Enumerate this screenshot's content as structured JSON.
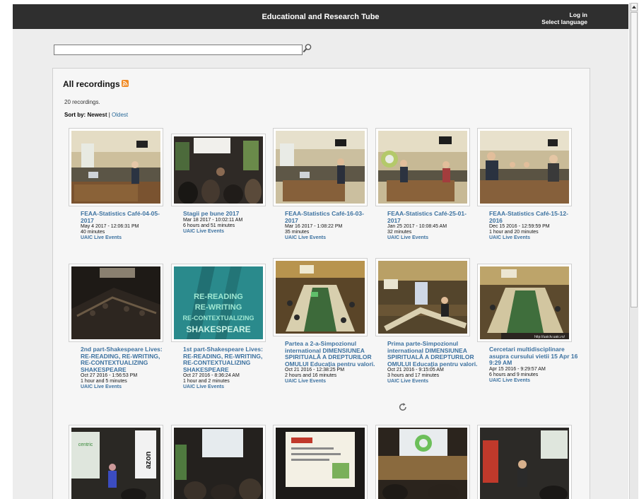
{
  "header": {
    "title": "Educational and Research Tube",
    "login": "Log in",
    "language": "Select language"
  },
  "search": {
    "value": "",
    "placeholder": ""
  },
  "main": {
    "title": "All recordings",
    "count_text": "20 recordings.",
    "sort": {
      "label": "Sort by:",
      "current": "Newest",
      "separator": "|",
      "other": "Oldest"
    }
  },
  "recordings": [
    {
      "title": "FEAA-Statistics Café-04-05-2017",
      "date": "May 4 2017 - 12:06:31 PM",
      "duration": "40 minutes",
      "channel": "UAIC Live Events"
    },
    {
      "title": "Stagii pe bune 2017",
      "date": "Mar 18 2017 - 10:02:11 AM",
      "duration": "6 hours and 51 minutes",
      "channel": "UAIC Live Events"
    },
    {
      "title": "FEAA-Statistics Café-16-03-2017",
      "date": "Mar 16 2017 - 1:08:22 PM",
      "duration": "35 minutes",
      "channel": "UAIC Live Events"
    },
    {
      "title": "FEAA-Statistics Café-25-01-2017",
      "date": "Jan 25 2017 - 10:08:45 AM",
      "duration": "32 minutes",
      "channel": "UAIC Live Events"
    },
    {
      "title": "FEAA-Statistics Café-15-12-2016",
      "date": "Dec 15 2016 - 12:59:59 PM",
      "duration": "1 hour and 20 minutes",
      "channel": "UAIC Live Events"
    },
    {
      "title": "2nd part-Shakespeare Lives: RE-READING, RE-WRITING, RE-CONTEXTUALIZING SHAKESPEARE",
      "date": "Oct 27 2016 - 1:56:53 PM",
      "duration": "1 hour and 5 minutes",
      "channel": "UAIC Live Events"
    },
    {
      "title": "1st part-Shakespeare Lives: RE-READING, RE-WRITING, RE-CONTEXTUALIZING SHAKESPEARE",
      "date": "Oct 27 2016 - 8:36:24 AM",
      "duration": "1 hour and 2 minutes",
      "channel": "UAIC Live Events"
    },
    {
      "title": "Partea a 2-a-Simpozionul international DIMENSIUNEA SPIRITUALĂ A DREPTURILOR OMULUI Educația pentru valori.",
      "date": "Oct 21 2016 - 12:38:25 PM",
      "duration": "2 hours and 16 minutes",
      "channel": "UAIC Live Events"
    },
    {
      "title": "Prima parte-Simpozionul international DIMENSIUNEA SPIRITUALĂ A DREPTURILOR OMULUI Educația pentru valori.",
      "date": "Oct 21 2016 - 9:15:05 AM",
      "duration": "3 hours and 17 minutes",
      "channel": "UAIC Live Events"
    },
    {
      "title": "Cercetari multidisciplinare asupra cursului vietii 15 Apr 16 9:29 AM",
      "date": "Apr 15 2016 - 9:29:57 AM",
      "duration": "6 hours and 9 minutes",
      "channel": "UAIC Live Events"
    }
  ],
  "thumbnail_texts": {
    "shakespeare_lines": [
      "RE-READING",
      "RE-WRITING",
      "RE-CONTEXTUALIZING",
      "SHAKESPEARE"
    ],
    "watermark": "http://uaictv.uaic.ro/",
    "sponsor_word": "azon",
    "sponsor_brand": "centric"
  },
  "icons": {
    "search": "magnifier-icon",
    "rss": "rss-icon",
    "refresh": "refresh-icon"
  },
  "colors": {
    "header_bg": "#2f2f2f",
    "link": "#3d72a0",
    "rss": "#f08a24"
  }
}
